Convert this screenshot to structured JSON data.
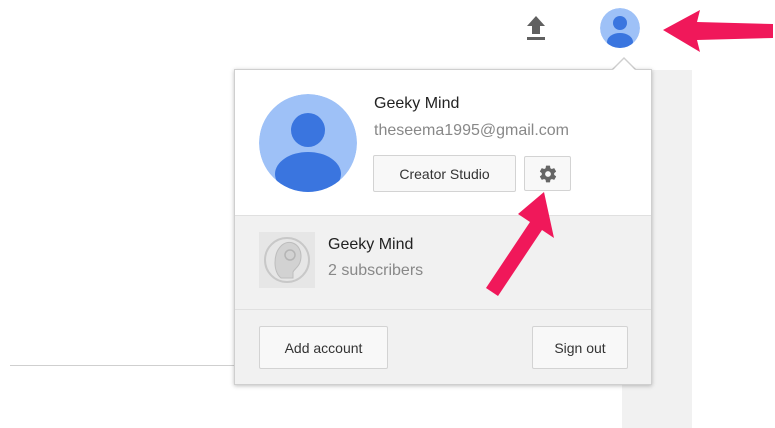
{
  "header": {
    "upload_icon": "upload-icon",
    "avatar_icon": "avatar-icon"
  },
  "account": {
    "name": "Geeky Mind",
    "email": "theseema1995@gmail.com",
    "creator_studio_label": "Creator Studio",
    "settings_icon": "gear-icon"
  },
  "channel": {
    "name": "Geeky Mind",
    "subscribers": "2 subscribers"
  },
  "footer": {
    "add_account_label": "Add account",
    "sign_out_label": "Sign out"
  },
  "colors": {
    "avatar_bg": "#9ec1f7",
    "avatar_fg": "#3a75df",
    "annotation_arrow": "#f0185a"
  }
}
